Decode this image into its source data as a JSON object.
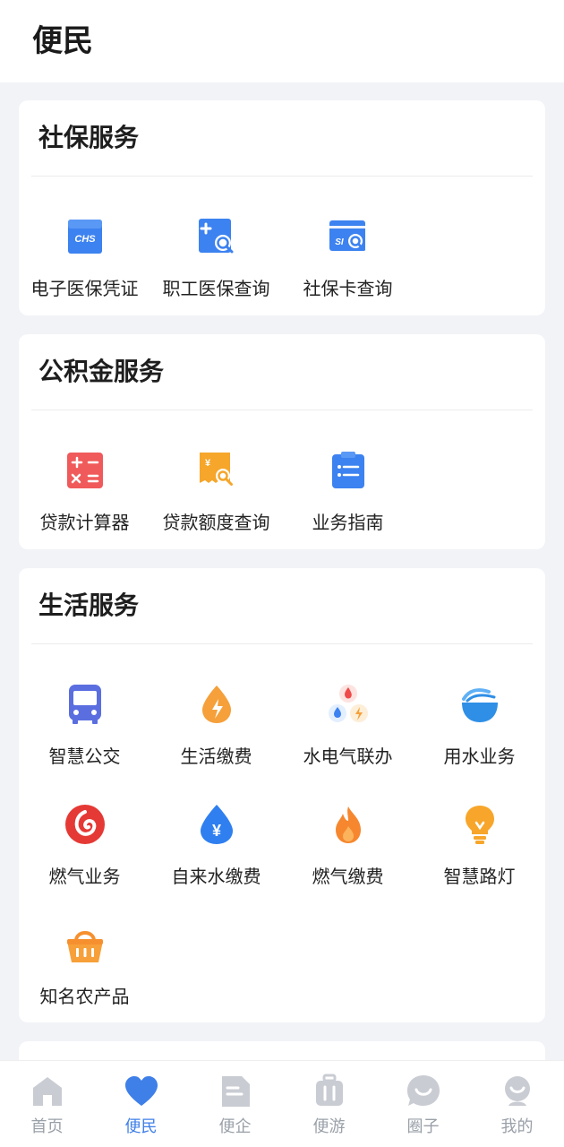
{
  "header": {
    "title": "便民"
  },
  "sections": [
    {
      "title": "社保服务",
      "items": [
        {
          "label": "电子医保凭证",
          "icon": "chs-card-icon"
        },
        {
          "label": "职工医保查询",
          "icon": "medical-search-icon"
        },
        {
          "label": "社保卡查询",
          "icon": "si-card-search-icon"
        }
      ]
    },
    {
      "title": "公积金服务",
      "items": [
        {
          "label": "贷款计算器",
          "icon": "calculator-icon"
        },
        {
          "label": "贷款额度查询",
          "icon": "receipt-search-icon"
        },
        {
          "label": "业务指南",
          "icon": "clipboard-guide-icon"
        }
      ]
    },
    {
      "title": "生活服务",
      "items": [
        {
          "label": "智慧公交",
          "icon": "bus-icon"
        },
        {
          "label": "生活缴费",
          "icon": "lightning-drop-icon"
        },
        {
          "label": "水电气联办",
          "icon": "utilities-combo-icon"
        },
        {
          "label": "用水业务",
          "icon": "water-bowl-icon"
        },
        {
          "label": "燃气业务",
          "icon": "gas-swirl-icon"
        },
        {
          "label": "自来水缴费",
          "icon": "yuan-drop-icon"
        },
        {
          "label": "燃气缴费",
          "icon": "flame-icon"
        },
        {
          "label": "智慧路灯",
          "icon": "bulb-icon"
        },
        {
          "label": "知名农产品",
          "icon": "basket-icon"
        }
      ]
    }
  ],
  "tabbar": [
    {
      "label": "首页",
      "icon": "home-icon",
      "active": false
    },
    {
      "label": "便民",
      "icon": "heart-icon",
      "active": true
    },
    {
      "label": "便企",
      "icon": "document-icon",
      "active": false
    },
    {
      "label": "便游",
      "icon": "luggage-icon",
      "active": false
    },
    {
      "label": "圈子",
      "icon": "chat-smile-icon",
      "active": false
    },
    {
      "label": "我的",
      "icon": "profile-icon",
      "active": false
    }
  ],
  "colors": {
    "accent": "#3f7fe8",
    "inactive": "#c9ccd3",
    "background": "#f2f3f7"
  }
}
